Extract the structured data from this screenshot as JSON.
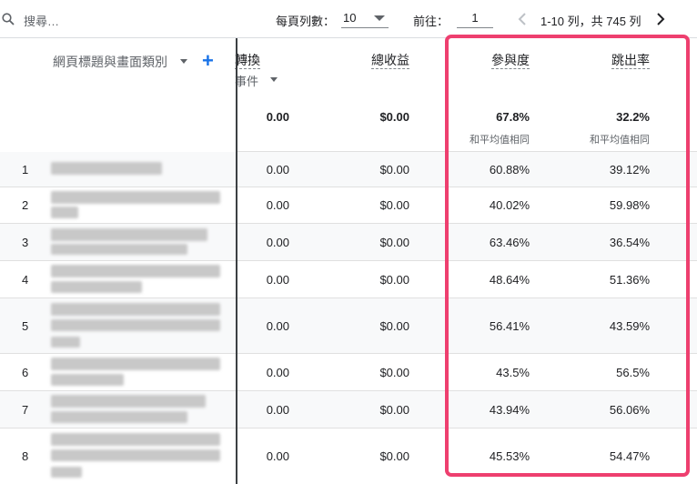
{
  "toolbar": {
    "search_placeholder": "搜尋…",
    "rows_per_page_label": "每頁列數：",
    "rows_per_page_value": "10",
    "goto_label": "前往：",
    "goto_value": "1",
    "range_text": "1-10 列，共 745 列"
  },
  "columns": {
    "dimension": "網頁標題與畫面類別",
    "conversions": "轉換",
    "conversions_sub": "事件",
    "revenue": "總收益",
    "engagement": "參與度",
    "bounce": "跳出率"
  },
  "totals": {
    "conversions": "0.00",
    "revenue": "$0.00",
    "engagement": "67.8%",
    "engagement_note": "和平均值相同",
    "bounce": "32.2%",
    "bounce_note": "和平均值相同"
  },
  "rows": [
    {
      "index": "1",
      "conversions": "0.00",
      "revenue": "$0.00",
      "engagement": "60.88%",
      "bounce": "39.12%"
    },
    {
      "index": "2",
      "conversions": "0.00",
      "revenue": "$0.00",
      "engagement": "40.02%",
      "bounce": "59.98%"
    },
    {
      "index": "3",
      "conversions": "0.00",
      "revenue": "$0.00",
      "engagement": "63.46%",
      "bounce": "36.54%"
    },
    {
      "index": "4",
      "conversions": "0.00",
      "revenue": "$0.00",
      "engagement": "48.64%",
      "bounce": "51.36%"
    },
    {
      "index": "5",
      "conversions": "0.00",
      "revenue": "$0.00",
      "engagement": "56.41%",
      "bounce": "43.59%"
    },
    {
      "index": "6",
      "conversions": "0.00",
      "revenue": "$0.00",
      "engagement": "43.5%",
      "bounce": "56.5%"
    },
    {
      "index": "7",
      "conversions": "0.00",
      "revenue": "$0.00",
      "engagement": "43.94%",
      "bounce": "56.06%"
    },
    {
      "index": "8",
      "conversions": "0.00",
      "revenue": "$0.00",
      "engagement": "45.53%",
      "bounce": "54.47%"
    }
  ],
  "colors": {
    "highlight": "#ee3f6f",
    "accent": "#1a73e8"
  }
}
